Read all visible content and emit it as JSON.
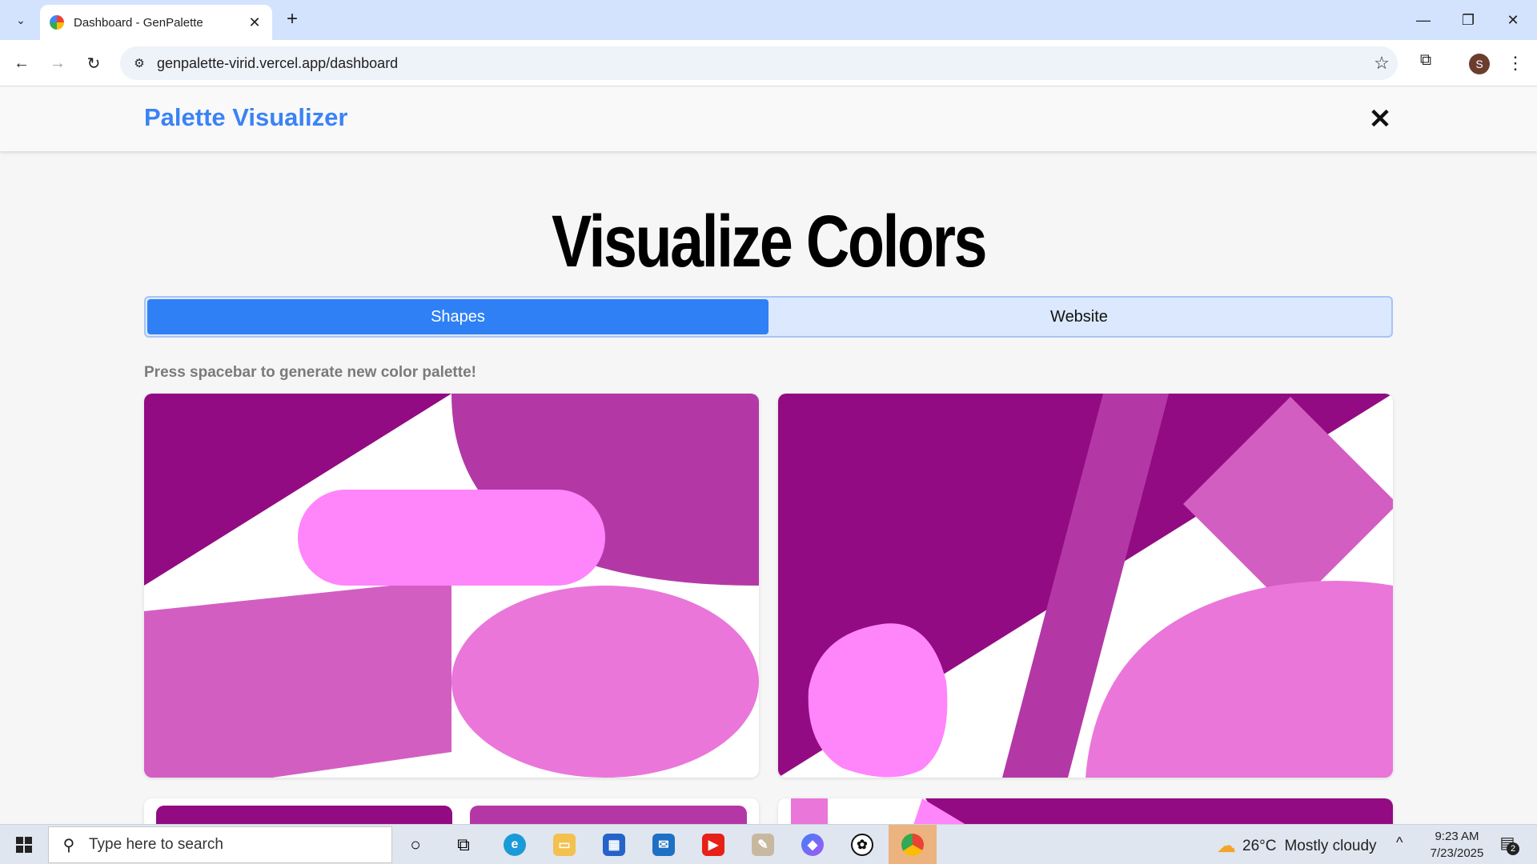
{
  "browser": {
    "tab_title": "Dashboard - GenPalette",
    "url": "genpalette-virid.vercel.app/dashboard",
    "profile_initial": "S"
  },
  "app": {
    "title": "Palette Visualizer",
    "heading": "Visualize Colors",
    "tabs": [
      {
        "label": "Shapes",
        "active": true
      },
      {
        "label": "Website",
        "active": false
      }
    ],
    "hint": "Press spacebar to generate new color palette!",
    "palette": {
      "primary": "#920b82",
      "secondary": "#b338a6",
      "accent": "#d35ec2",
      "light": "#ea76da",
      "highlight": "#ff85fb",
      "background": "#ffffff"
    }
  },
  "taskbar": {
    "search_placeholder": "Type here to search",
    "weather_temp": "26°C",
    "weather_text": "Mostly cloudy",
    "time": "9:23 AM",
    "date": "7/23/2025",
    "notification_count": "2"
  }
}
